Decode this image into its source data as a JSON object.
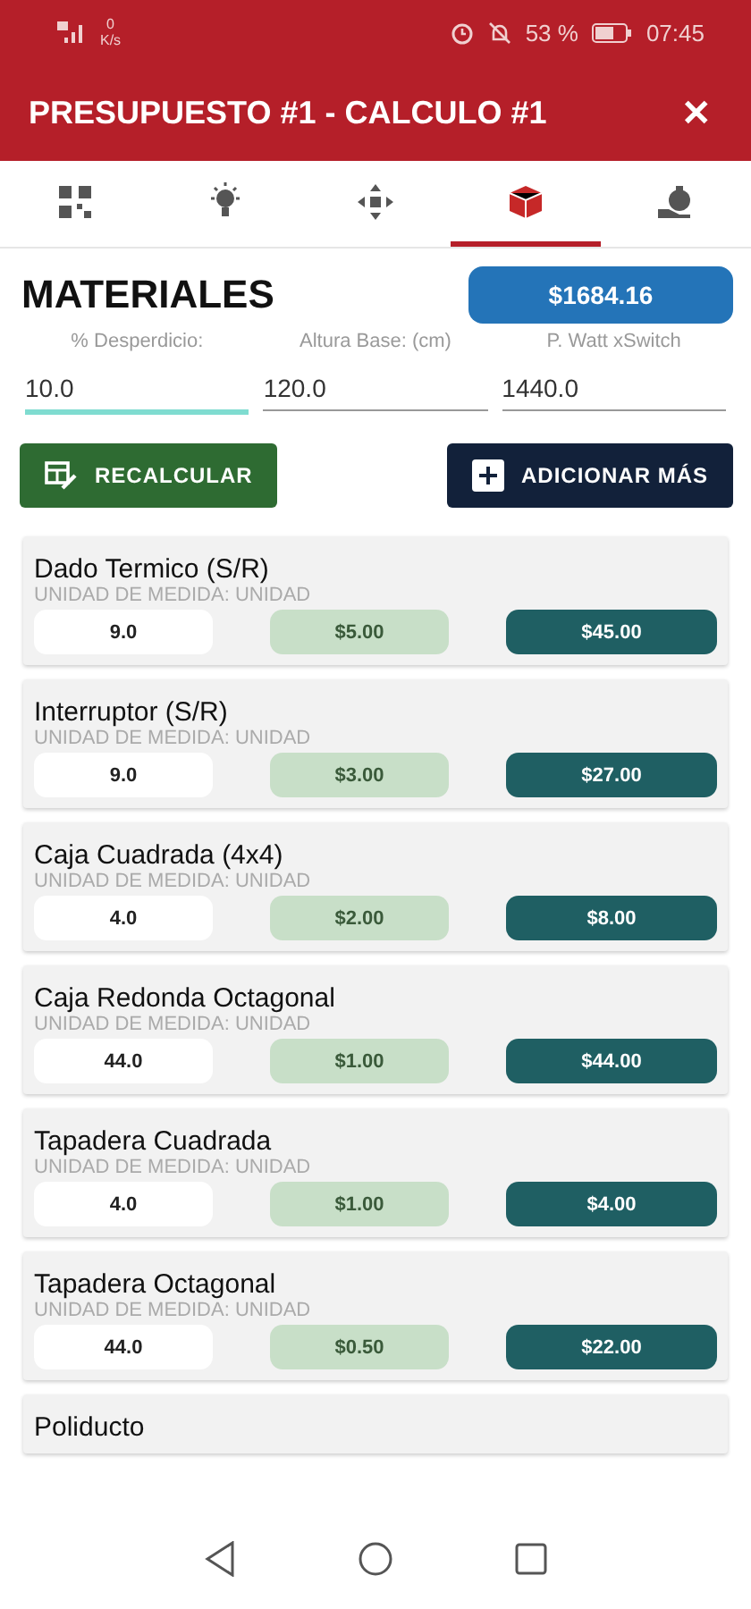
{
  "status_bar": {
    "speed_value": "0",
    "speed_unit": "K/s",
    "battery": "53 %",
    "time": "07:45"
  },
  "header": {
    "title": "PRESUPUESTO #1 - CALCULO #1",
    "close": "✕"
  },
  "tabs": [
    {
      "selected": false
    },
    {
      "selected": false
    },
    {
      "selected": false
    },
    {
      "selected": true
    },
    {
      "selected": false
    }
  ],
  "section": {
    "title": "MATERIALES",
    "total": "$1684.16"
  },
  "fields": [
    {
      "label": "% Desperdicio:",
      "value": "10.0",
      "focused": true
    },
    {
      "label": "Altura Base: (cm)",
      "value": "120.0",
      "focused": false
    },
    {
      "label": "P. Watt xSwitch",
      "value": "1440.0",
      "focused": false
    }
  ],
  "actions": {
    "recalc": "RECALCULAR",
    "add": "ADICIONAR MÁS"
  },
  "materials": [
    {
      "name": "Dado Termico (S/R)",
      "unit": "UNIDAD DE MEDIDA: UNIDAD",
      "qty": "9.0",
      "price": "$5.00",
      "total": "$45.00"
    },
    {
      "name": "Interruptor (S/R)",
      "unit": "UNIDAD DE MEDIDA: UNIDAD",
      "qty": "9.0",
      "price": "$3.00",
      "total": "$27.00"
    },
    {
      "name": "Caja Cuadrada (4x4)",
      "unit": "UNIDAD DE MEDIDA: UNIDAD",
      "qty": "4.0",
      "price": "$2.00",
      "total": "$8.00"
    },
    {
      "name": "Caja Redonda Octagonal",
      "unit": "UNIDAD DE MEDIDA: UNIDAD",
      "qty": "44.0",
      "price": "$1.00",
      "total": "$44.00"
    },
    {
      "name": "Tapadera Cuadrada",
      "unit": "UNIDAD DE MEDIDA: UNIDAD",
      "qty": "4.0",
      "price": "$1.00",
      "total": "$4.00"
    },
    {
      "name": "Tapadera Octagonal",
      "unit": "UNIDAD DE MEDIDA: UNIDAD",
      "qty": "44.0",
      "price": "$0.50",
      "total": "$22.00"
    },
    {
      "name": "Poliducto"
    }
  ]
}
